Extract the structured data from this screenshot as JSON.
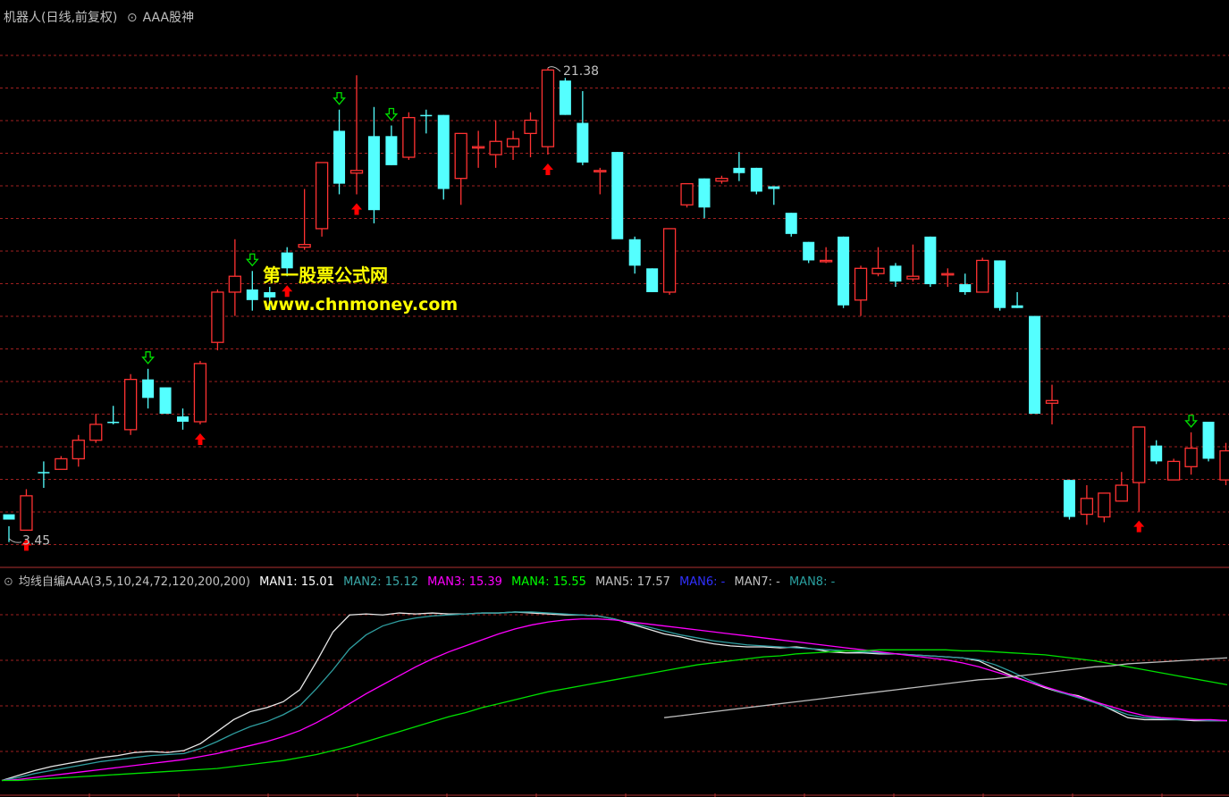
{
  "main_panel": {
    "formula_label": "机器人(日线,前复权)",
    "indicator_label": "AAA股神",
    "high_label": "21.38",
    "low_label": "3.45"
  },
  "watermark": {
    "line1": "第一股票公式网",
    "line2": "www.chnmoney.com"
  },
  "sub_panel": {
    "title": "均线自编AAA(3,5,10,24,72,120,200,200)",
    "legend": [
      {
        "label": "MAN1: 15.01",
        "color": "#ffffff"
      },
      {
        "label": "MAN2: 15.12",
        "color": "#3aa7a7"
      },
      {
        "label": "MAN3: 15.39",
        "color": "#ff00ff"
      },
      {
        "label": "MAN4: 15.55",
        "color": "#00ff00"
      },
      {
        "label": "MAN5: 17.57",
        "color": "#c0c0c0"
      },
      {
        "label": "MAN6: -",
        "color": "#0000ff"
      },
      {
        "label": "MAN7: -",
        "color": "#c0c0c0"
      },
      {
        "label": "MAN8: -",
        "color": "#2aa1a1"
      }
    ]
  },
  "colors": {
    "up": "#ff3232",
    "down": "#54ffff",
    "grid": "#a02020",
    "buy_arrow": "#ff0000",
    "sell_arrow": "#00e000"
  },
  "chart_data": [
    {
      "type": "candlestick",
      "title": "机器人(日线,前复权)",
      "ylim": [
        3.0,
        23.0
      ],
      "max_marker": 21.38,
      "min_marker": 3.45,
      "candles": [
        [
          4.3,
          4.5,
          4.05,
          3.45,
          "d"
        ],
        [
          3.9,
          5.2,
          5.45,
          3.9,
          "u"
        ],
        [
          6.1,
          6.1,
          6.5,
          5.5,
          "d"
        ],
        [
          6.2,
          6.6,
          6.7,
          6.2,
          "u"
        ],
        [
          6.6,
          7.3,
          7.5,
          6.3,
          "u"
        ],
        [
          7.3,
          7.9,
          8.3,
          7.2,
          "u"
        ],
        [
          8.0,
          8.0,
          8.6,
          7.9,
          "d"
        ],
        [
          7.7,
          9.6,
          9.8,
          7.5,
          "u"
        ],
        [
          9.6,
          8.9,
          10.0,
          8.5,
          "d"
        ],
        [
          9.3,
          8.3,
          9.3,
          8.3,
          "d"
        ],
        [
          8.2,
          8.0,
          8.5,
          7.7,
          "d"
        ],
        [
          8.0,
          10.2,
          10.3,
          7.9,
          "u"
        ],
        [
          11.0,
          12.9,
          13.0,
          10.7,
          "u"
        ],
        [
          12.9,
          13.5,
          14.9,
          12.0,
          "u"
        ],
        [
          13.0,
          12.6,
          13.7,
          12.2,
          "d"
        ],
        [
          12.7,
          12.9,
          13.1,
          12.2,
          "d"
        ],
        [
          13.8,
          14.4,
          14.6,
          13.5,
          "d"
        ],
        [
          14.6,
          14.7,
          16.8,
          14.5,
          "u"
        ],
        [
          15.3,
          17.8,
          17.8,
          15.0,
          "u"
        ],
        [
          19.0,
          17.0,
          19.8,
          16.6,
          "d"
        ],
        [
          17.4,
          17.5,
          21.1,
          16.6,
          "u"
        ],
        [
          16.0,
          18.8,
          19.9,
          15.5,
          "d"
        ],
        [
          17.7,
          18.8,
          19.2,
          17.7,
          "d"
        ],
        [
          19.5,
          18.0,
          19.7,
          17.9,
          "u"
        ],
        [
          19.6,
          19.6,
          19.8,
          18.9,
          "d"
        ],
        [
          19.6,
          16.8,
          19.6,
          16.4,
          "d"
        ],
        [
          17.2,
          18.9,
          18.9,
          16.2,
          "u"
        ],
        [
          18.4,
          18.4,
          19.0,
          17.6,
          "u"
        ],
        [
          18.1,
          18.6,
          19.4,
          17.6,
          "u"
        ],
        [
          18.4,
          18.7,
          19.0,
          17.9,
          "u"
        ],
        [
          18.9,
          19.4,
          19.7,
          18.0,
          "u"
        ],
        [
          18.4,
          21.3,
          21.38,
          18.1,
          "u"
        ],
        [
          20.9,
          19.6,
          21.0,
          19.6,
          "d"
        ],
        [
          19.3,
          17.8,
          20.5,
          17.7,
          "d"
        ],
        [
          17.5,
          17.5,
          17.6,
          16.6,
          "u"
        ],
        [
          18.2,
          14.9,
          18.2,
          15.0,
          "d"
        ],
        [
          14.9,
          13.9,
          15.0,
          13.6,
          "d"
        ],
        [
          13.8,
          12.9,
          13.8,
          12.9,
          "d"
        ],
        [
          12.9,
          15.3,
          15.3,
          12.8,
          "u"
        ],
        [
          17.0,
          16.2,
          17.0,
          16.1,
          "u"
        ],
        [
          17.2,
          16.1,
          17.2,
          15.7,
          "d"
        ],
        [
          17.1,
          17.2,
          17.3,
          17.0,
          "u"
        ],
        [
          17.4,
          17.6,
          18.2,
          17.1,
          "d"
        ],
        [
          17.6,
          16.7,
          17.6,
          16.6,
          "d"
        ],
        [
          16.9,
          16.8,
          16.9,
          16.2,
          "d"
        ],
        [
          15.9,
          15.1,
          15.9,
          15.0,
          "d"
        ],
        [
          14.8,
          14.1,
          14.8,
          14.0,
          "d"
        ],
        [
          14.1,
          14.1,
          14.6,
          14.0,
          "u"
        ],
        [
          15.0,
          12.4,
          15.0,
          12.3,
          "d"
        ],
        [
          12.6,
          13.8,
          13.9,
          12.0,
          "u"
        ],
        [
          13.6,
          13.8,
          14.6,
          13.5,
          "u"
        ],
        [
          13.9,
          13.3,
          14.0,
          13.1,
          "d"
        ],
        [
          13.4,
          13.5,
          14.7,
          13.3,
          "u"
        ],
        [
          15.0,
          13.2,
          15.0,
          13.1,
          "d"
        ],
        [
          13.6,
          13.6,
          13.8,
          13.1,
          "u"
        ],
        [
          13.2,
          12.9,
          13.6,
          12.8,
          "d"
        ],
        [
          12.9,
          14.1,
          14.2,
          12.9,
          "u"
        ],
        [
          14.1,
          12.3,
          14.1,
          12.2,
          "d"
        ],
        [
          12.4,
          12.3,
          12.9,
          12.3,
          "d"
        ],
        [
          12.0,
          8.3,
          12.0,
          8.3,
          "d"
        ],
        [
          8.8,
          8.7,
          9.4,
          7.9,
          "u"
        ],
        [
          5.8,
          4.4,
          5.8,
          4.3,
          "d"
        ],
        [
          4.5,
          5.1,
          5.6,
          4.1,
          "u"
        ],
        [
          4.4,
          5.3,
          5.3,
          4.2,
          "u"
        ],
        [
          5.0,
          5.6,
          6.1,
          5.0,
          "u"
        ],
        [
          5.7,
          7.8,
          7.8,
          4.6,
          "u"
        ],
        [
          7.1,
          6.5,
          7.3,
          6.4,
          "d"
        ],
        [
          5.8,
          6.5,
          6.6,
          5.8,
          "u"
        ],
        [
          6.3,
          7.0,
          7.6,
          6.0,
          "u"
        ],
        [
          8.0,
          6.6,
          8.0,
          6.5,
          "d"
        ],
        [
          5.8,
          6.9,
          7.2,
          5.6,
          "u"
        ],
        [
          6.0,
          6.8,
          7.0,
          5.9,
          "u"
        ],
        [
          6.6,
          6.9,
          7.4,
          6.2,
          "d"
        ],
        [
          6.0,
          6.4,
          7.1,
          6.0,
          "d"
        ],
        [
          6.1,
          6.4,
          6.9,
          6.0,
          "d"
        ]
      ],
      "buy_signals": [
        1,
        11,
        16,
        20,
        31,
        65
      ],
      "sell_signals": [
        8,
        14,
        19,
        22,
        68
      ]
    },
    {
      "type": "line",
      "title": "均线自编AAA(3,5,10,24,72,120,200,200)",
      "ylim": [
        3.0,
        22.0
      ],
      "series": [
        {
          "name": "MAN1",
          "color": "#e8e8e8",
          "values": [
            4.3,
            4.8,
            5.3,
            5.7,
            6.0,
            6.3,
            6.6,
            6.8,
            7.1,
            7.2,
            7.1,
            7.3,
            8.0,
            9.2,
            10.4,
            11.2,
            11.6,
            12.2,
            13.4,
            16.2,
            19.2,
            20.9,
            21.0,
            20.9,
            21.1,
            21.0,
            21.1,
            21.0,
            21.0,
            21.1,
            21.1,
            21.2,
            21.1,
            21.0,
            20.9,
            20.9,
            20.8,
            20.5,
            20.0,
            19.5,
            19.0,
            18.7,
            18.3,
            18.0,
            17.8,
            17.7,
            17.7,
            17.6,
            17.7,
            17.5,
            17.2,
            17.1,
            17.1,
            17.0,
            17.0,
            16.9,
            16.8,
            16.7,
            16.6,
            16.3,
            15.5,
            14.8,
            14.2,
            13.6,
            13.1,
            12.8,
            12.2,
            11.4,
            10.6,
            10.4,
            10.4,
            10.4,
            10.3,
            10.3,
            10.3
          ]
        },
        {
          "name": "MAN2",
          "color": "#2f9ea0",
          "values": [
            4.3,
            4.6,
            5.0,
            5.3,
            5.6,
            5.9,
            6.2,
            6.4,
            6.6,
            6.8,
            6.9,
            7.0,
            7.5,
            8.2,
            9.0,
            9.7,
            10.2,
            10.9,
            11.8,
            13.5,
            15.4,
            17.5,
            18.9,
            19.8,
            20.3,
            20.6,
            20.8,
            20.9,
            21.0,
            21.1,
            21.1,
            21.2,
            21.2,
            21.1,
            21.0,
            20.9,
            20.8,
            20.5,
            20.1,
            19.7,
            19.3,
            18.9,
            18.6,
            18.3,
            18.1,
            17.9,
            17.8,
            17.7,
            17.6,
            17.5,
            17.4,
            17.3,
            17.2,
            17.1,
            17.0,
            16.9,
            16.8,
            16.7,
            16.6,
            16.4,
            15.9,
            15.2,
            14.4,
            13.7,
            13.1,
            12.6,
            12.1,
            11.5,
            10.9,
            10.6,
            10.5,
            10.4,
            10.4,
            10.3,
            10.3
          ]
        },
        {
          "name": "MAN3",
          "color": "#ff00ff",
          "values": [
            4.3,
            4.4,
            4.6,
            4.8,
            5.0,
            5.2,
            5.4,
            5.6,
            5.8,
            6.0,
            6.2,
            6.4,
            6.7,
            7.0,
            7.4,
            7.8,
            8.2,
            8.7,
            9.3,
            10.1,
            11.0,
            12.0,
            13.0,
            13.9,
            14.8,
            15.7,
            16.5,
            17.2,
            17.8,
            18.4,
            19.0,
            19.5,
            19.9,
            20.2,
            20.4,
            20.5,
            20.5,
            20.4,
            20.2,
            20.0,
            19.8,
            19.6,
            19.4,
            19.2,
            19.0,
            18.8,
            18.6,
            18.4,
            18.2,
            18.0,
            17.8,
            17.6,
            17.4,
            17.2,
            17.0,
            16.8,
            16.6,
            16.4,
            16.1,
            15.7,
            15.2,
            14.7,
            14.2,
            13.7,
            13.2,
            12.7,
            12.2,
            11.7,
            11.2,
            10.8,
            10.6,
            10.5,
            10.4,
            10.4,
            10.3
          ]
        },
        {
          "name": "MAN4",
          "color": "#00e000",
          "values": [
            4.3,
            4.3,
            4.4,
            4.5,
            4.6,
            4.7,
            4.8,
            4.9,
            5.0,
            5.1,
            5.2,
            5.3,
            5.4,
            5.5,
            5.7,
            5.9,
            6.1,
            6.3,
            6.6,
            6.9,
            7.3,
            7.7,
            8.2,
            8.7,
            9.2,
            9.7,
            10.2,
            10.7,
            11.1,
            11.6,
            12.0,
            12.4,
            12.8,
            13.2,
            13.5,
            13.8,
            14.1,
            14.4,
            14.7,
            15.0,
            15.3,
            15.6,
            15.9,
            16.1,
            16.3,
            16.5,
            16.7,
            16.8,
            17.0,
            17.1,
            17.2,
            17.3,
            17.3,
            17.4,
            17.4,
            17.4,
            17.4,
            17.4,
            17.3,
            17.3,
            17.2,
            17.1,
            17.0,
            16.9,
            16.7,
            16.5,
            16.3,
            16.0,
            15.7,
            15.4,
            15.1,
            14.8,
            14.5,
            14.2,
            13.9
          ]
        },
        {
          "name": "MAN5",
          "color": "#bdbdbd",
          "start": 40,
          "values": [
            10.6,
            10.8,
            11.0,
            11.2,
            11.4,
            11.6,
            11.8,
            12.0,
            12.2,
            12.4,
            12.6,
            12.8,
            13.0,
            13.2,
            13.4,
            13.6,
            13.8,
            14.0,
            14.2,
            14.4,
            14.5,
            14.7,
            14.9,
            15.1,
            15.3,
            15.5,
            15.7,
            15.8,
            16.0,
            16.1,
            16.2,
            16.3,
            16.4,
            16.5,
            16.6
          ]
        }
      ]
    }
  ]
}
